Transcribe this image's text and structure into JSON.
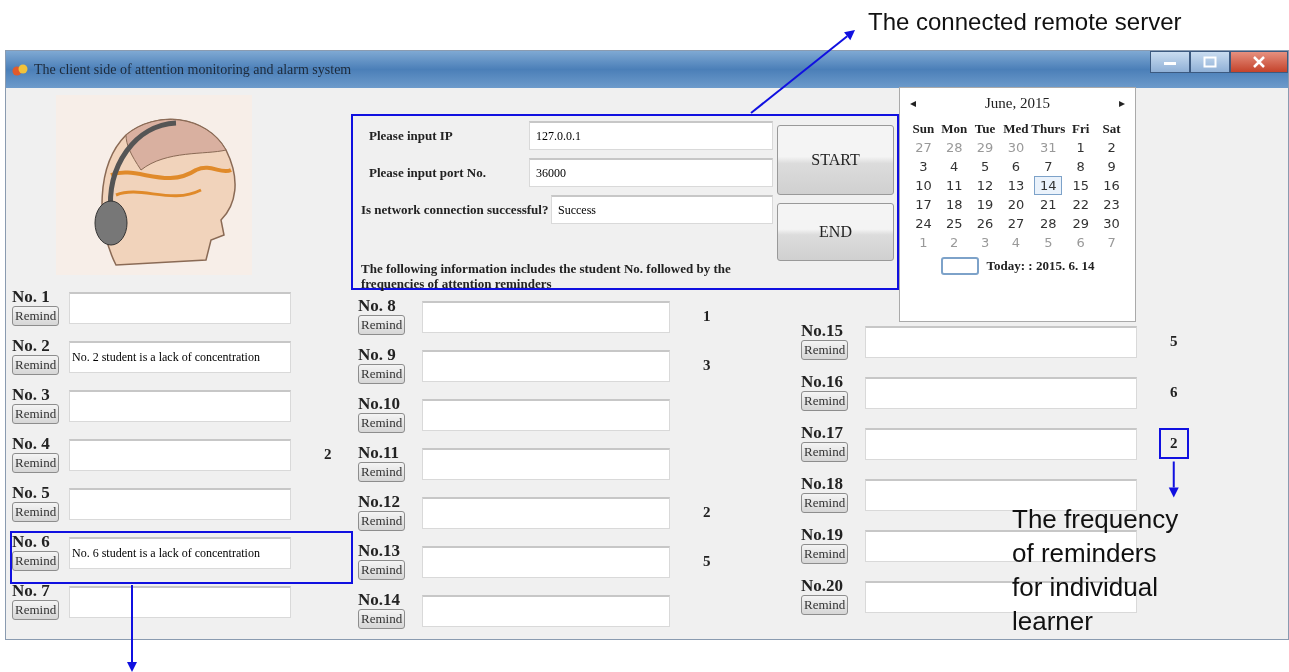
{
  "window": {
    "title": "The client side of attention monitoring and alarm system"
  },
  "connection": {
    "highlighted": true,
    "fields": [
      {
        "label": "Please input IP",
        "value": "127.0.0.1"
      },
      {
        "label": "Please input port No.",
        "value": "36000"
      },
      {
        "label": "Is network connection successful?",
        "value": "Success"
      }
    ],
    "buttons": [
      "START",
      "END"
    ],
    "info": "The following information includes the student No. followed by the frequencies of attention reminders"
  },
  "calendar": {
    "month": "June, 2015",
    "prev": "◂",
    "next": "▸",
    "weekdays": [
      "Sun",
      "Mon",
      "Tue",
      "Med",
      "Thurs",
      "Fri",
      "Sat"
    ],
    "weeks": [
      [
        {
          "day": "27",
          "muted": true,
          "selected": false
        },
        {
          "day": "28",
          "muted": true,
          "selected": false
        },
        {
          "day": "29",
          "muted": true,
          "selected": false
        },
        {
          "day": "30",
          "muted": true,
          "selected": false
        },
        {
          "day": "31",
          "muted": true,
          "selected": false
        },
        {
          "day": "1",
          "muted": false,
          "selected": false
        },
        {
          "day": "2",
          "muted": false,
          "selected": false
        }
      ],
      [
        {
          "day": "3",
          "muted": false,
          "selected": false
        },
        {
          "day": "4",
          "muted": false,
          "selected": false
        },
        {
          "day": "5",
          "muted": false,
          "selected": false
        },
        {
          "day": "6",
          "muted": false,
          "selected": false
        },
        {
          "day": "7",
          "muted": false,
          "selected": false
        },
        {
          "day": "8",
          "muted": false,
          "selected": false
        },
        {
          "day": "9",
          "muted": false,
          "selected": false
        }
      ],
      [
        {
          "day": "10",
          "muted": false,
          "selected": false
        },
        {
          "day": "11",
          "muted": false,
          "selected": false
        },
        {
          "day": "12",
          "muted": false,
          "selected": false
        },
        {
          "day": "13",
          "muted": false,
          "selected": false
        },
        {
          "day": "14",
          "muted": false,
          "selected": true
        },
        {
          "day": "15",
          "muted": false,
          "selected": false
        },
        {
          "day": "16",
          "muted": false,
          "selected": false
        }
      ],
      [
        {
          "day": "17",
          "muted": false,
          "selected": false
        },
        {
          "day": "18",
          "muted": false,
          "selected": false
        },
        {
          "day": "19",
          "muted": false,
          "selected": false
        },
        {
          "day": "20",
          "muted": false,
          "selected": false
        },
        {
          "day": "21",
          "muted": false,
          "selected": false
        },
        {
          "day": "22",
          "muted": false,
          "selected": false
        },
        {
          "day": "23",
          "muted": false,
          "selected": false
        }
      ],
      [
        {
          "day": "24",
          "muted": false,
          "selected": false
        },
        {
          "day": "25",
          "muted": false,
          "selected": false
        },
        {
          "day": "26",
          "muted": false,
          "selected": false
        },
        {
          "day": "27",
          "muted": false,
          "selected": false
        },
        {
          "day": "28",
          "muted": false,
          "selected": false
        },
        {
          "day": "29",
          "muted": false,
          "selected": false
        },
        {
          "day": "30",
          "muted": false,
          "selected": false
        }
      ],
      [
        {
          "day": "1",
          "muted": true,
          "selected": false
        },
        {
          "day": "2",
          "muted": true,
          "selected": false
        },
        {
          "day": "3",
          "muted": true,
          "selected": false
        },
        {
          "day": "4",
          "muted": true,
          "selected": false
        },
        {
          "day": "5",
          "muted": true,
          "selected": false
        },
        {
          "day": "6",
          "muted": true,
          "selected": false
        },
        {
          "day": "7",
          "muted": true,
          "selected": false
        }
      ]
    ],
    "today": "Today: : 2015. 6. 14"
  },
  "student_columns": [
    {
      "students": [
        {
          "label": "No. 1",
          "button": "Remind",
          "highlighted": false,
          "count_highlighted": false
        },
        {
          "label": "No. 2",
          "button": "Remind",
          "message": "No. 2 student is a lack of concentration",
          "highlighted": false,
          "count_highlighted": false
        },
        {
          "label": "No. 3",
          "button": "Remind",
          "highlighted": false,
          "count_highlighted": false
        },
        {
          "label": "No. 4",
          "button": "Remind",
          "count": "2",
          "highlighted": false,
          "count_highlighted": false
        },
        {
          "label": "No. 5",
          "button": "Remind",
          "highlighted": false,
          "count_highlighted": false
        },
        {
          "label": "No. 6",
          "button": "Remind",
          "message": "No. 6 student is a lack of concentration",
          "highlighted": true,
          "count_highlighted": false
        },
        {
          "label": "No. 7",
          "button": "Remind",
          "highlighted": false,
          "count_highlighted": false
        }
      ]
    },
    {
      "students": [
        {
          "label": "No. 8",
          "button": "Remind",
          "count": "1",
          "highlighted": false,
          "count_highlighted": false
        },
        {
          "label": "No. 9",
          "button": "Remind",
          "count": "3",
          "highlighted": false,
          "count_highlighted": false
        },
        {
          "label": "No.10",
          "button": "Remind",
          "highlighted": false,
          "count_highlighted": false
        },
        {
          "label": "No.11",
          "button": "Remind",
          "highlighted": false,
          "count_highlighted": false
        },
        {
          "label": "No.12",
          "button": "Remind",
          "count": "2",
          "highlighted": false,
          "count_highlighted": false
        },
        {
          "label": "No.13",
          "button": "Remind",
          "count": "5",
          "highlighted": false,
          "count_highlighted": false
        },
        {
          "label": "No.14",
          "button": "Remind",
          "highlighted": false,
          "count_highlighted": false
        }
      ]
    },
    {
      "students": [
        {
          "label": "No.15",
          "button": "Remind",
          "count": "5",
          "highlighted": false,
          "count_highlighted": false
        },
        {
          "label": "No.16",
          "button": "Remind",
          "count": "6",
          "highlighted": false,
          "count_highlighted": false
        },
        {
          "label": "No.17",
          "button": "Remind",
          "count": "2",
          "highlighted": false,
          "count_highlighted": true
        },
        {
          "label": "No.18",
          "button": "Remind",
          "highlighted": false,
          "count_highlighted": false
        },
        {
          "label": "No.19",
          "button": "Remind",
          "highlighted": false,
          "count_highlighted": false
        },
        {
          "label": "No.20",
          "button": "Remind",
          "highlighted": false,
          "count_highlighted": false
        }
      ]
    }
  ],
  "annotations": [
    {
      "kind": "server",
      "text": "The connected remote server"
    },
    {
      "kind": "student"
    },
    {
      "kind": "frequency",
      "text": "The frequency of reminders for individual learner"
    }
  ]
}
